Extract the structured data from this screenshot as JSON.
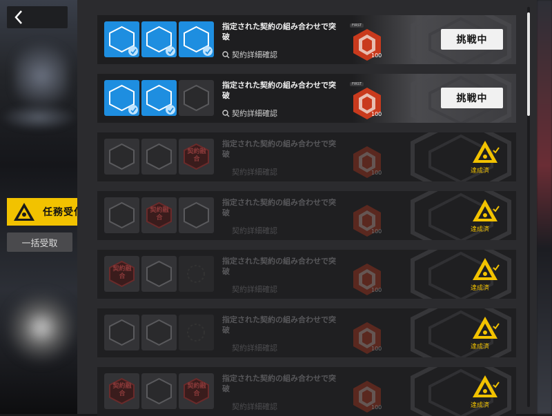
{
  "nav": {
    "back_icon": "chevron-left-icon",
    "tab_label": "任務受付",
    "claim_all_label": "一括受取"
  },
  "colors": {
    "accent": "#f2c200",
    "slot_blue": "#1e8ee0",
    "reward_red": "#c93a1d",
    "panel": "#2b2b2e"
  },
  "rows": [
    {
      "title": "指定された契約の組み合わせで突破",
      "detail": "契約詳細確認",
      "reward_tag": "FIRST",
      "reward_count": "100",
      "status": "挑戦中",
      "slots": [
        "blue",
        "blue",
        "blue"
      ]
    },
    {
      "title": "指定された契約の組み合わせで突破",
      "detail": "契約詳細確認",
      "reward_tag": "FIRST",
      "reward_count": "100",
      "status": "挑戦中",
      "slots": [
        "blue",
        "blue",
        "grey"
      ]
    },
    {
      "title": "指定された契約の組み合わせで突破",
      "detail": "契約詳細確認",
      "reward_count": "100",
      "status": "達成済",
      "slots": [
        "grey",
        "grey",
        "red"
      ]
    },
    {
      "title": "指定された契約の組み合わせで突破",
      "detail": "契約詳細確認",
      "reward_count": "100",
      "status": "達成済",
      "slots": [
        "grey",
        "red",
        "grey"
      ]
    },
    {
      "title": "指定された契約の組み合わせで突破",
      "detail": "契約詳細確認",
      "reward_count": "100",
      "status": "達成済",
      "slots": [
        "red",
        "grey",
        "empty"
      ]
    },
    {
      "title": "指定された契約の組み合わせで突破",
      "detail": "契約詳細確認",
      "reward_count": "100",
      "status": "達成済",
      "slots": [
        "grey",
        "grey",
        "empty"
      ]
    },
    {
      "title": "指定された契約の組み合わせで突破",
      "detail": "契約詳細確認",
      "reward_count": "100",
      "status": "達成済",
      "slots": [
        "red",
        "grey",
        "red"
      ]
    }
  ],
  "contract_badge_text": "契約融合"
}
